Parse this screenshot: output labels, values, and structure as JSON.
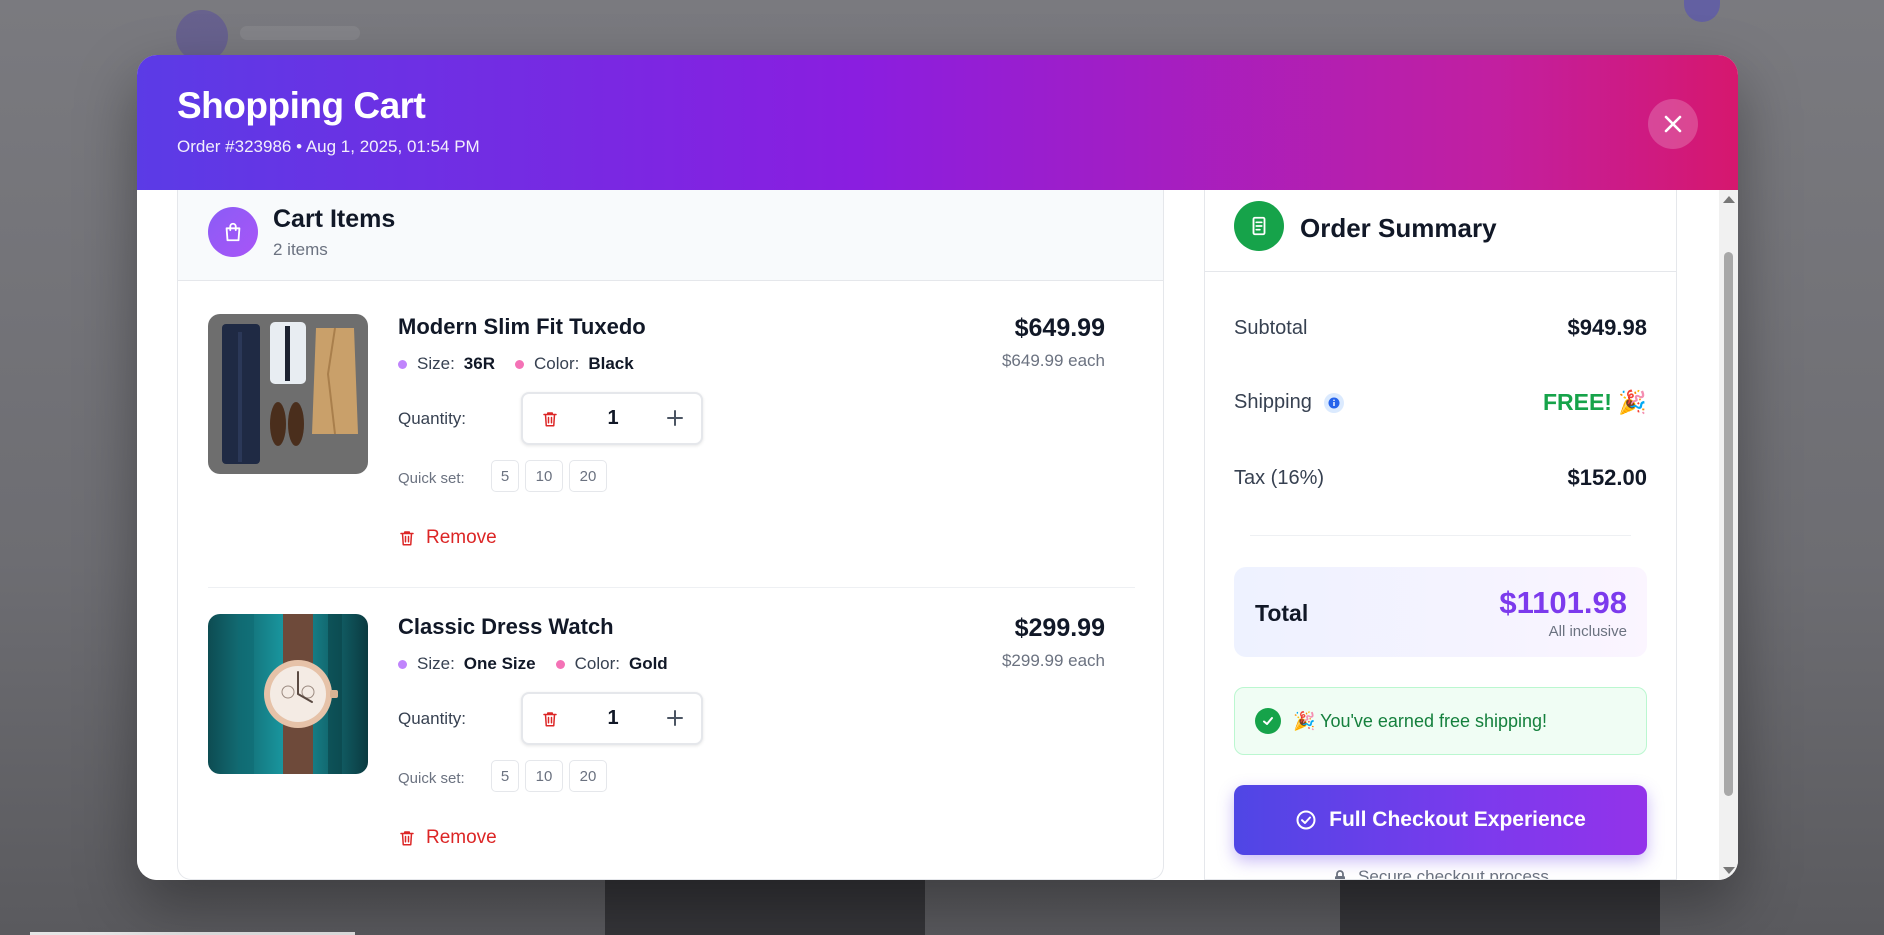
{
  "header": {
    "title": "Shopping Cart",
    "subtitle": "Order #323986 • Aug 1, 2025, 01:54 PM",
    "close_icon": "close-icon"
  },
  "cart": {
    "title": "Cart Items",
    "count": "2 items",
    "items": [
      {
        "name": "Modern Slim Fit Tuxedo",
        "size_label": "Size:",
        "size": "36R",
        "color_label": "Color:",
        "color": "Black",
        "quantity_label": "Quantity:",
        "quantity": "1",
        "quick_label": "Quick set:",
        "quick": [
          "5",
          "10",
          "20"
        ],
        "remove_label": "Remove",
        "price": "$649.99",
        "each": "$649.99 each"
      },
      {
        "name": "Classic Dress Watch",
        "size_label": "Size:",
        "size": "One Size",
        "color_label": "Color:",
        "color": "Gold",
        "quantity_label": "Quantity:",
        "quantity": "1",
        "quick_label": "Quick set:",
        "quick": [
          "5",
          "10",
          "20"
        ],
        "remove_label": "Remove",
        "price": "$299.99",
        "each": "$299.99 each"
      }
    ]
  },
  "summary": {
    "title": "Order Summary",
    "subtotal_label": "Subtotal",
    "subtotal": "$949.98",
    "shipping_label": "Shipping",
    "shipping": "FREE! 🎉",
    "tax_label": "Tax (16%)",
    "tax": "$152.00",
    "total_label": "Total",
    "total": "$1101.98",
    "total_note": "All inclusive",
    "free_shipping_notice": "🎉 You've earned free shipping!",
    "checkout_label": "Full Checkout Experience",
    "secure_text": "Secure checkout process"
  },
  "colors": {
    "header_gradient_start": "#5b3be6",
    "header_gradient_end": "#d6176e",
    "accent_purple": "#7c3aed",
    "success_green": "#16a34a",
    "danger_red": "#dc2626"
  }
}
